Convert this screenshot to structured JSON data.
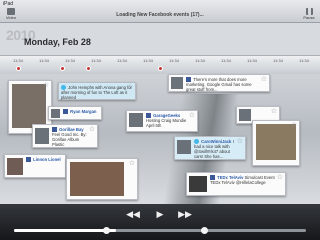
{
  "status": {
    "left": "iPad",
    "right": ""
  },
  "title": "Loading New Facebook events (17)...",
  "toolbar": {
    "video_label": "Video",
    "pause_label": "Pause"
  },
  "header": {
    "year": "2010",
    "date": "Monday, Feb 28"
  },
  "timeline": {
    "ticks": [
      "11:34",
      "11:34",
      "11:34",
      "11:34",
      "11:34",
      "11:34",
      "11:34",
      "11:34",
      "11:34",
      "11:34",
      "11:34",
      "11:34"
    ],
    "event_dots": 4
  },
  "cards": [
    {
      "id": "c1",
      "name": "",
      "text": "John Hemphs with Anova gang for after morning of fun to The Loft as it planned",
      "source": "twitter"
    },
    {
      "id": "c2",
      "name": "",
      "text": "There's more that does more marketing. Google Gmail has some great stuff from...",
      "source": "facebook"
    },
    {
      "id": "c3",
      "name": "Ryan Margan",
      "text": "",
      "source": "facebook"
    },
    {
      "id": "c4",
      "name": "GarageGeeks",
      "text": "Hosting Craig Mundie April 6th",
      "source": "facebook"
    },
    {
      "id": "c5",
      "name": "Gorillae Bay",
      "text": "Feel Good Inc. By: Gorillae Album Plastic",
      "source": "facebook"
    },
    {
      "id": "c6",
      "name": "CaroWinniJack",
      "text": "I had a nice talk with @Swill!!!!k47 about cars! She has...",
      "source": "twitter"
    },
    {
      "id": "c7",
      "name": "Linnon Lionel",
      "text": "",
      "source": "facebook"
    },
    {
      "id": "c8",
      "name": "TEDx TelAviv",
      "text": "Simulcast Event TEDx TelAviv @HillelaCollege",
      "source": "facebook"
    },
    {
      "id": "c9",
      "name": "",
      "text": "",
      "source": "facebook"
    },
    {
      "id": "c10",
      "name": "",
      "text": "",
      "source": "facebook"
    }
  ],
  "playback": {
    "prev_icon": "rewind-icon",
    "play_icon": "play-icon",
    "next_icon": "fast-forward-icon",
    "progress": 0.35
  }
}
